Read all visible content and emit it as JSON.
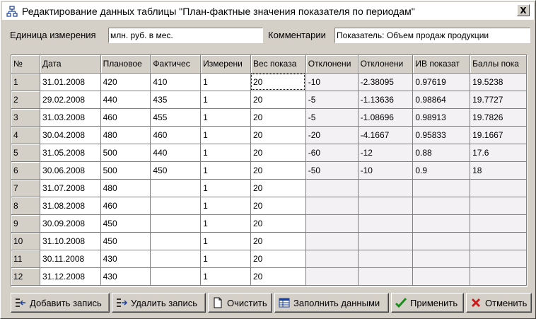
{
  "window": {
    "title": "Редактирование данных таблицы  \"План-фактные значения показателя по периодам\"",
    "close_label": "X"
  },
  "form": {
    "unit_label": "Единица измерения",
    "unit_value": "млн. руб. в мес.",
    "comment_label": "Комментарии",
    "comment_value": "Показатель: Объем продаж продукции"
  },
  "table": {
    "headers": [
      "№",
      "Дата",
      "Плановое",
      "Фактичес",
      "Измерени",
      "Вес показа",
      "Отклонени",
      "Отклонени",
      "ИВ показат",
      "Баллы пока"
    ],
    "rows": [
      [
        "1",
        "31.01.2008",
        "420",
        "410",
        "1",
        "20",
        "-10",
        "-2.38095",
        "0.97619",
        "19.5238"
      ],
      [
        "2",
        "29.02.2008",
        "440",
        "435",
        "1",
        "20",
        "-5",
        "-1.13636",
        "0.98864",
        "19.7727"
      ],
      [
        "3",
        "31.03.2008",
        "460",
        "455",
        "1",
        "20",
        "-5",
        "-1.08696",
        "0.98913",
        "19.7826"
      ],
      [
        "4",
        "30.04.2008",
        "480",
        "460",
        "1",
        "20",
        "-20",
        "-4.1667",
        "0.95833",
        "19.1667"
      ],
      [
        "5",
        "31.05.2008",
        "500",
        "440",
        "1",
        "20",
        "-60",
        "-12",
        "0.88",
        "17.6"
      ],
      [
        "6",
        "30.06.2008",
        "500",
        "450",
        "1",
        "20",
        "-50",
        "-10",
        "0.9",
        "18"
      ],
      [
        "7",
        "31.07.2008",
        "480",
        "",
        "1",
        "20",
        "",
        "",
        "",
        ""
      ],
      [
        "8",
        "31.08.2008",
        "460",
        "",
        "1",
        "20",
        "",
        "",
        "",
        ""
      ],
      [
        "9",
        "30.09.2008",
        "450",
        "",
        "1",
        "20",
        "",
        "",
        "",
        ""
      ],
      [
        "10",
        "31.10.2008",
        "450",
        "",
        "1",
        "20",
        "",
        "",
        "",
        ""
      ],
      [
        "11",
        "30.11.2008",
        "430",
        "",
        "1",
        "20",
        "",
        "",
        "",
        ""
      ],
      [
        "12",
        "31.12.2008",
        "430",
        "",
        "1",
        "20",
        "",
        "",
        "",
        ""
      ]
    ]
  },
  "buttons": {
    "add": "Добавить запись",
    "delete": "Удалить запись",
    "clear": "Очистить",
    "fill": "Заполнить данными",
    "apply": "Применить",
    "cancel": "Отменить"
  },
  "colors": {
    "apply_icon": "#1a8c1a",
    "cancel_icon": "#cc1a1a",
    "readonly_cell": "#f3f1f4"
  }
}
